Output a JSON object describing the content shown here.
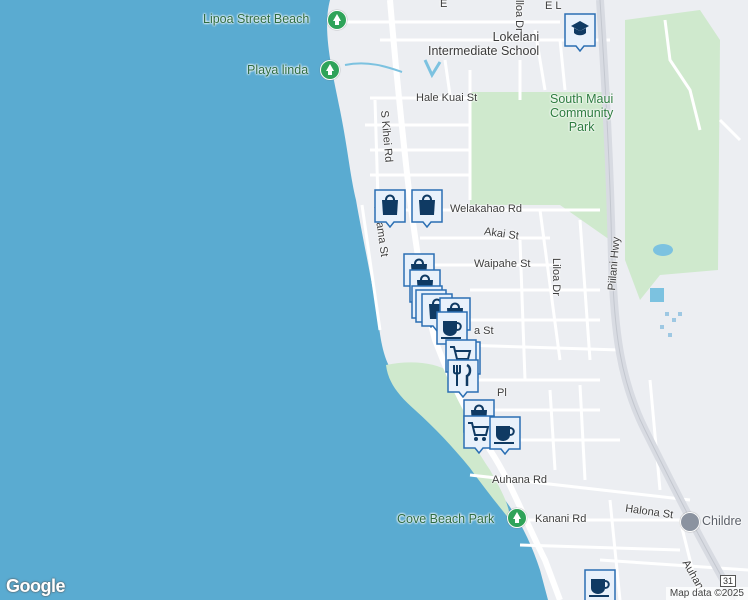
{
  "map": {
    "colors": {
      "water": "#5aabd1",
      "land": "#eceef2",
      "park": "#cfe9cd",
      "road": "#ffffff",
      "highway": "#d8dbe2",
      "marker_fill": "#0f3a63",
      "marker_bg": "#e8f1fb",
      "marker_border": "#2b6fb3"
    },
    "roads": [
      {
        "id": "s-kihei-rd",
        "label": "S Kihei Rd"
      },
      {
        "id": "pillani-hwy",
        "label": "Piilani Hwy"
      },
      {
        "id": "hale-kuai-st",
        "label": "Hale Kuai St"
      },
      {
        "id": "welakahao-rd",
        "label": "Welakahao Rd"
      },
      {
        "id": "akai-st",
        "label": "Akai St"
      },
      {
        "id": "waipahe-st",
        "label": "Waipahe St"
      },
      {
        "id": "liloa-dr",
        "label": "Liloa Dr"
      },
      {
        "id": "liloa-dr-north",
        "label": "lloa Dr"
      },
      {
        "id": "halama-st",
        "label": "Halama St"
      },
      {
        "id": "auhana-rd",
        "label": "Auhana Rd"
      },
      {
        "id": "auhana-rd-2",
        "label": "Auhan"
      },
      {
        "id": "kanani-rd",
        "label": "Kanani Rd"
      },
      {
        "id": "halona-st",
        "label": "Halona St"
      },
      {
        "id": "ia-st",
        "label": "a St"
      },
      {
        "id": "pl",
        "label": "Pl"
      },
      {
        "id": "e-l",
        "label": "E L"
      },
      {
        "id": "e-l2",
        "label": "E"
      }
    ],
    "pois": [
      {
        "id": "lipoa-street-beach",
        "label": "Lipoa Street Beach",
        "kind": "park-pin"
      },
      {
        "id": "playa-linda",
        "label": "Playa linda",
        "kind": "park-pin"
      },
      {
        "id": "cove-beach-park",
        "label": "Cove Beach Park",
        "kind": "park-pin"
      },
      {
        "id": "lokelani-school",
        "label": "Lokelani Intermediate School",
        "line1": "Lokelani",
        "line2": "Intermediate School",
        "kind": "school"
      },
      {
        "id": "south-maui-park",
        "line1": "South Maui",
        "line2": "Community",
        "line3": "Park",
        "kind": "park"
      },
      {
        "id": "children",
        "label": "Childre",
        "kind": "grey-pin"
      }
    ],
    "shield": "31",
    "markers": [
      {
        "icon": "graduation-cap-icon"
      },
      {
        "icon": "shopping-bag-icon"
      },
      {
        "icon": "shopping-bag-icon"
      },
      {
        "icon": "shopping-bag-icon"
      },
      {
        "icon": "shopping-bag-icon"
      },
      {
        "icon": "shopping-bag-icon"
      },
      {
        "icon": "shopping-bag-icon"
      },
      {
        "icon": "shopping-bag-icon"
      },
      {
        "icon": "shopping-bag-icon"
      },
      {
        "icon": "coffee-cup-icon"
      },
      {
        "icon": "shopping-cart-icon"
      },
      {
        "icon": "shopping-cart-icon"
      },
      {
        "icon": "restaurant-icon"
      },
      {
        "icon": "shopping-bag-icon"
      },
      {
        "icon": "shopping-cart-icon"
      },
      {
        "icon": "coffee-cup-icon"
      },
      {
        "icon": "coffee-cup-icon"
      }
    ],
    "attribution": {
      "logo": "Google",
      "data": "Map data ©2025"
    }
  }
}
